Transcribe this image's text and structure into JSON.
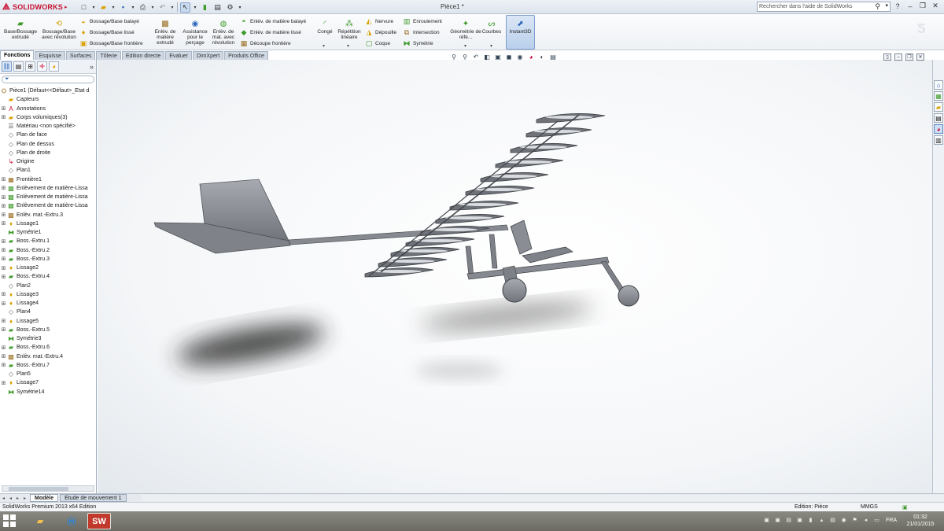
{
  "app": {
    "logo_text": "SOLIDWORKS",
    "document_title": "Pièce1 *",
    "search_placeholder": "Rechercher dans l'aide de SolidWorks"
  },
  "command_manager": {
    "features": {
      "extruded_boss": "Base/Bossage extrudé",
      "revolved_boss": "Bossage/Base avec révolution",
      "swept_boss": "Bossage/Base balayé",
      "lofted_boss": "Bossage/Base lissé",
      "boundary_boss": "Bossage/Base frontière",
      "extruded_cut": "Enlèv. de matière extrudé",
      "hole_wizard": "Assistance pour le perçage",
      "revolved_cut": "Enlèv. de mat. avec révolution",
      "swept_cut": "Enlèv. de matière balayé",
      "lofted_cut": "Enlèv. de matière lissé",
      "boundary_cut": "Découpe frontière",
      "fillet": "Congé",
      "linear_pattern": "Répétition linéaire",
      "rib": "Nervure",
      "draft": "Dépouille",
      "shell": "Coque",
      "wrap": "Enroulement",
      "intersect": "Intersection",
      "mirror": "Symétrie",
      "reference_geometry": "Géométrie de réfé...",
      "curves": "Courbes",
      "instant3d": "Instant3D"
    },
    "tabs": [
      "Fonctions",
      "Esquisse",
      "Surfaces",
      "Tôlerie",
      "Edition directe",
      "Evaluer",
      "DimXpert",
      "Produits Office"
    ]
  },
  "feature_tree": {
    "root": "Pièce1  (Défaut<<Défaut>_Etat d",
    "items": [
      {
        "label": "Capteurs",
        "icon": "folder-icon",
        "expandable": false
      },
      {
        "label": "Annotations",
        "icon": "annotation-icon",
        "expandable": true
      },
      {
        "label": "Corps volumiques(3)",
        "icon": "folder-icon",
        "expandable": true
      },
      {
        "label": "Matériau <non spécifié>",
        "icon": "material-icon",
        "expandable": false
      },
      {
        "label": "Plan de face",
        "icon": "plane-icon",
        "expandable": false
      },
      {
        "label": "Plan de dessus",
        "icon": "plane-icon",
        "expandable": false
      },
      {
        "label": "Plan de droite",
        "icon": "plane-icon",
        "expandable": false
      },
      {
        "label": "Origine",
        "icon": "origin-icon",
        "expandable": false
      },
      {
        "label": "Plan1",
        "icon": "plane-icon",
        "expandable": false
      },
      {
        "label": "Frontière1",
        "icon": "boundary-icon",
        "expandable": true
      },
      {
        "label": "Enlèvement de matière-Lissa",
        "icon": "lofted-cut-icon",
        "expandable": true
      },
      {
        "label": "Enlèvement de matière-Lissa",
        "icon": "lofted-cut-icon",
        "expandable": true
      },
      {
        "label": "Enlèvement de matière-Lissa",
        "icon": "lofted-cut-icon",
        "expandable": true
      },
      {
        "label": "Enlèv. mat.-Extru.3",
        "icon": "extruded-cut-icon",
        "expandable": true
      },
      {
        "label": "Lissage1",
        "icon": "loft-icon",
        "expandable": true
      },
      {
        "label": "Symétrie1",
        "icon": "mirror-icon",
        "expandable": false
      },
      {
        "label": "Boss.-Extru.1",
        "icon": "extrude-icon",
        "expandable": true
      },
      {
        "label": "Boss.-Extru.2",
        "icon": "extrude-icon",
        "expandable": true
      },
      {
        "label": "Boss.-Extru.3",
        "icon": "extrude-icon",
        "expandable": true
      },
      {
        "label": "Lissage2",
        "icon": "loft-icon",
        "expandable": true
      },
      {
        "label": "Boss.-Extru.4",
        "icon": "extrude-icon",
        "expandable": true
      },
      {
        "label": "Plan2",
        "icon": "plane-icon",
        "expandable": false
      },
      {
        "label": "Lissage3",
        "icon": "loft-icon",
        "expandable": true
      },
      {
        "label": "Lissage4",
        "icon": "loft-icon",
        "expandable": true
      },
      {
        "label": "Plan4",
        "icon": "plane-icon",
        "expandable": false
      },
      {
        "label": "Lissage5",
        "icon": "loft-icon",
        "expandable": true
      },
      {
        "label": "Boss.-Extru.5",
        "icon": "extrude-icon",
        "expandable": true
      },
      {
        "label": "Symétrie3",
        "icon": "mirror-icon",
        "expandable": false
      },
      {
        "label": "Boss.-Extru.6",
        "icon": "extrude-icon",
        "expandable": true
      },
      {
        "label": "Enlèv. mat.-Extru.4",
        "icon": "extruded-cut-icon",
        "expandable": true
      },
      {
        "label": "Boss.-Extru.7",
        "icon": "extrude-icon",
        "expandable": true
      },
      {
        "label": "Plan5",
        "icon": "plane-icon",
        "expandable": false
      },
      {
        "label": "Lissage7",
        "icon": "loft-icon",
        "expandable": true
      },
      {
        "label": "Symétrie14",
        "icon": "mirror-icon",
        "expandable": false
      }
    ]
  },
  "bottom_tabs": [
    "Modèle",
    "Etude de mouvement 1"
  ],
  "status_bar": {
    "product": "SolidWorks Premium 2013 x64 Edition",
    "mode": "Edition: Pièce",
    "units": "MMGS"
  },
  "taskbar": {
    "language": "FRA",
    "time": "01:32",
    "date": "21/01/2015"
  },
  "colors": {
    "model_gray": "#8f9399",
    "brand_red": "#c8102e",
    "selection_blue": "#b9cfeb"
  }
}
